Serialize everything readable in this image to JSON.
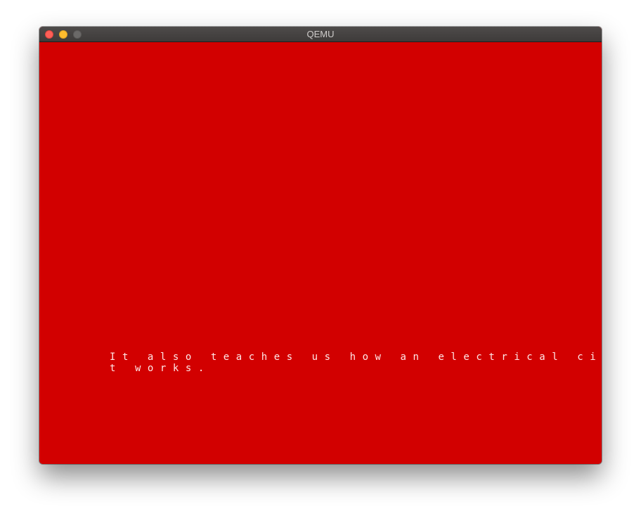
{
  "window": {
    "title": "QEMU"
  },
  "screen": {
    "background_color": "#d20000",
    "text_color": "#ffe8e8",
    "lines": [
      "It also teaches us how an electrical circui",
      "t works."
    ]
  }
}
